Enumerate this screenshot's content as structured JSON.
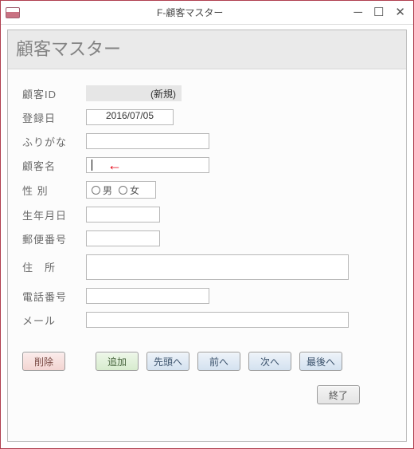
{
  "window": {
    "title": "F-顧客マスター"
  },
  "form": {
    "title": "顧客マスター",
    "labels": {
      "id": "顧客ID",
      "regdate": "登録日",
      "furigana": "ふりがな",
      "name": "顧客名",
      "gender": "性 別",
      "birth": "生年月日",
      "postal": "郵便番号",
      "address": "住　所",
      "phone": "電話番号",
      "email": "メール"
    },
    "values": {
      "id": "(新規)",
      "regdate": "2016/07/05",
      "furigana": "",
      "name": "",
      "birth": "",
      "postal": "",
      "address": "",
      "phone": "",
      "email": ""
    },
    "gender": {
      "male": "男",
      "female": "女"
    }
  },
  "buttons": {
    "delete": "削除",
    "add": "追加",
    "first": "先頭へ",
    "prev": "前へ",
    "next": "次へ",
    "last": "最後へ",
    "close": "終了"
  }
}
